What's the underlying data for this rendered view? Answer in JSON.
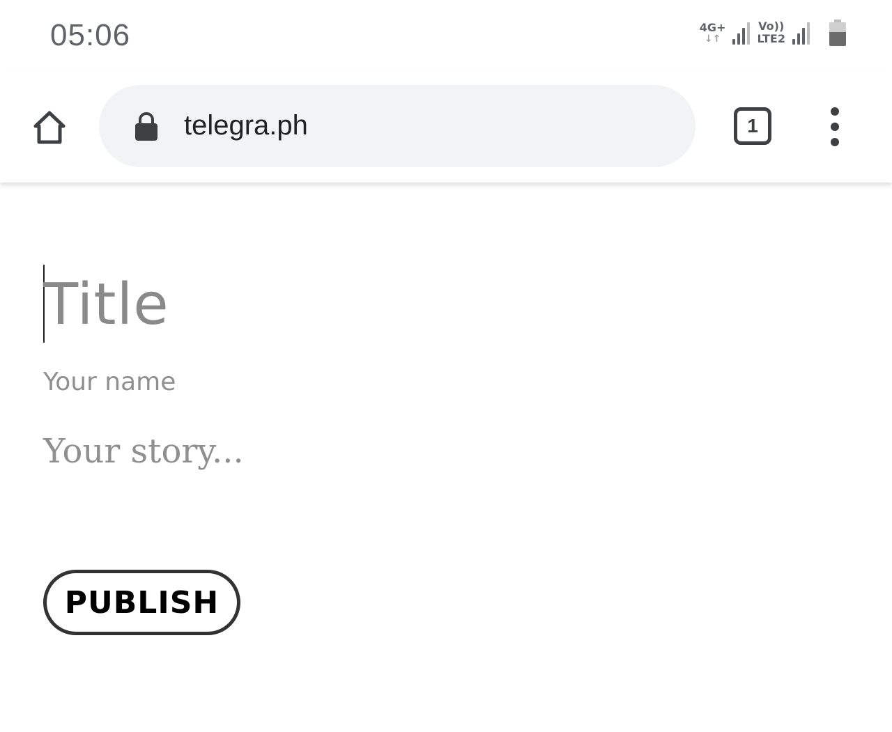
{
  "status_bar": {
    "time": "05:06",
    "network_1": {
      "label": "4G+",
      "arrows": "↓↑"
    },
    "network_2": {
      "line1": "Vo))",
      "line2": "LTE2"
    },
    "battery_level": 0.6
  },
  "browser": {
    "home_icon": "home-icon",
    "lock_icon": "lock-icon",
    "url": "telegra.ph",
    "tab_count": "1",
    "menu_icon": "more-vert-icon"
  },
  "editor": {
    "title_placeholder": "Title",
    "author_placeholder": "Your name",
    "story_placeholder": "Your story...",
    "publish_label": "PUBLISH"
  },
  "colors": {
    "placeholder": "#8f8f8f",
    "url_bar_bg": "#f1f3f4",
    "icon": "#3c4043"
  }
}
